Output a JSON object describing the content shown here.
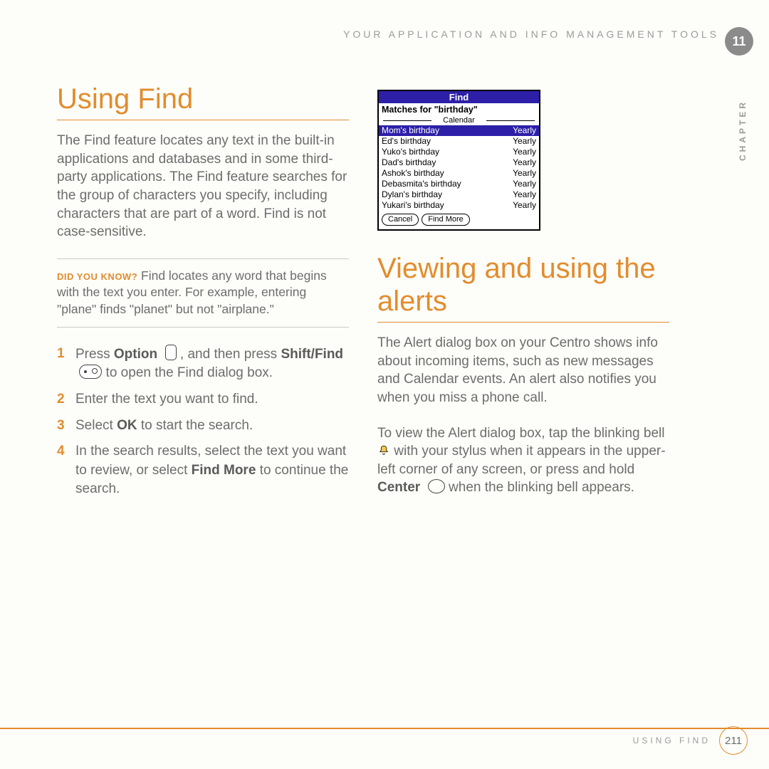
{
  "header": {
    "title": "YOUR APPLICATION AND INFO MANAGEMENT TOOLS",
    "chapter_number": "11",
    "side_label": "CHAPTER"
  },
  "left": {
    "heading": "Using Find",
    "intro": "The Find feature locates any text in the built-in applications and databases and in some third-party applications. The Find feature searches for the group of characters you specify, including characters that are part of a word. Find is not case-sensitive.",
    "tip_label": "DID YOU KNOW?",
    "tip_text": " Find locates any word that begins with the text you enter. For example, entering \"plane\" finds \"planet\" but not \"airplane.\"",
    "steps": {
      "s1a": "Press ",
      "s1_option": "Option",
      "s1b": " , and then press ",
      "s1_shift": "Shift/Find",
      "s1c": " to open the Find dialog box.",
      "s2": "Enter the text you want to find.",
      "s3a": "Select ",
      "s3_ok": "OK",
      "s3b": " to start the search.",
      "s4a": "In the search results, select the text you want to review, or select ",
      "s4_findmore": "Find More",
      "s4b": " to continue the search."
    }
  },
  "find_dialog": {
    "title": "Find",
    "matches": "Matches for \"birthday\"",
    "group": "Calendar",
    "rows": [
      {
        "name": "Mom's birthday",
        "freq": "Yearly",
        "hl": true
      },
      {
        "name": "Ed's birthday",
        "freq": "Yearly"
      },
      {
        "name": "Yuko's birthday",
        "freq": "Yearly"
      },
      {
        "name": "Dad's birthday",
        "freq": "Yearly"
      },
      {
        "name": "Ashok's birthday",
        "freq": "Yearly"
      },
      {
        "name": "Debasmita's birthday",
        "freq": "Yearly"
      },
      {
        "name": "Dylan's birthday",
        "freq": "Yearly"
      },
      {
        "name": "Yukari's birthday",
        "freq": "Yearly"
      }
    ],
    "cancel": "Cancel",
    "find_more": "Find More"
  },
  "right": {
    "heading": "Viewing and using the alerts",
    "p1": "The Alert dialog box on your Centro shows info about incoming items, such as new messages and Calendar events. An alert also notifies you when you miss a phone call.",
    "p2a": "To view the Alert dialog box, tap the blinking bell ",
    "p2b": " with your stylus when it appears in the upper-left corner of any screen, or press and hold ",
    "p2_center": "Center",
    "p2c": " when the blinking bell appears."
  },
  "footer": {
    "label": "USING FIND",
    "page": "211"
  }
}
